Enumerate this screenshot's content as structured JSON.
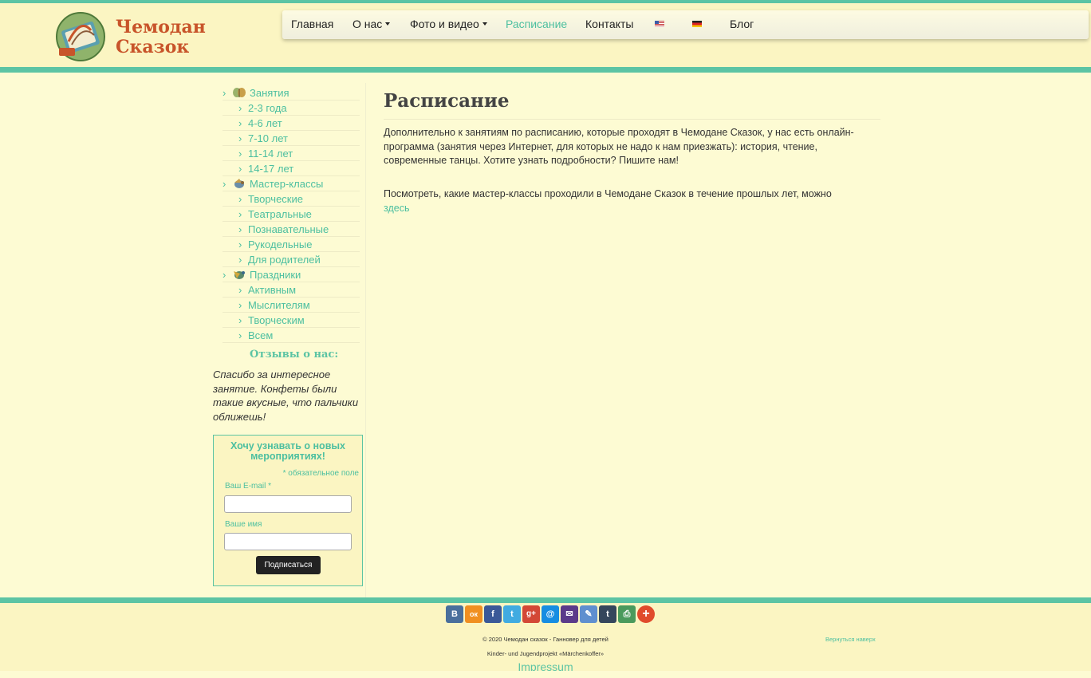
{
  "brand": {
    "line1": "Чемодан",
    "line2": "Сказок"
  },
  "nav": [
    {
      "label": "Главная"
    },
    {
      "label": "О нас"
    },
    {
      "label": "Фото и видео"
    },
    {
      "label": "Расписание",
      "active": true
    },
    {
      "label": "Контакты"
    },
    {
      "label": "Блог"
    }
  ],
  "sidebar": {
    "menu": [
      {
        "label": "Занятия",
        "level": 1,
        "icon": "butterfly-icon"
      },
      {
        "label": "2-3 года",
        "level": 2
      },
      {
        "label": "4-6 лет",
        "level": 2
      },
      {
        "label": "7-10 лет",
        "level": 2
      },
      {
        "label": "11-14 лет",
        "level": 2
      },
      {
        "label": "14-17 лет",
        "level": 2
      },
      {
        "label": "Мастер-классы",
        "level": 1,
        "icon": "bird-icon"
      },
      {
        "label": "Творческие",
        "level": 2
      },
      {
        "label": "Театральные",
        "level": 2
      },
      {
        "label": "Познавательные",
        "level": 2
      },
      {
        "label": "Рукодельные",
        "level": 2
      },
      {
        "label": "Для родителей",
        "level": 2
      },
      {
        "label": "Праздники",
        "level": 1,
        "icon": "bird-icon"
      },
      {
        "label": "Активным",
        "level": 2
      },
      {
        "label": "Мыслителям",
        "level": 2
      },
      {
        "label": "Творческим",
        "level": 2
      },
      {
        "label": "Всем",
        "level": 2
      }
    ],
    "reviews_title": "Отзывы о нас:",
    "review_text": "Спасибо за интересное занятие. Конфеты были такие вкусные, что пальчики оближешь!",
    "subscribe": {
      "title": "Хочу узнавать о новых мероприятиях!",
      "required_note": "* обязательное поле",
      "email_label": "Ваш E-mail *",
      "email_value": "",
      "name_label": "Ваше имя",
      "name_value": "",
      "button_label": "Подписаться"
    }
  },
  "main": {
    "title": "Расписание",
    "paragraph1": "Дополнительно к занятиям по расписанию, которые проходят в Чемодане Сказок, у нас есть онлайн-программа (занятия через Интернет, для которых не надо к нам приезжать): история, чтение, современные танцы. Хотите узнать подробности? Пишите нам!",
    "paragraph2": "Посмотреть, какие мастер-классы проходили в Чемодане Сказок в течение прошлых лет, можно",
    "link_label": "здесь"
  },
  "footer": {
    "share_buttons": [
      {
        "name": "vk-icon",
        "glyph": "В",
        "color": "#4a6f9c"
      },
      {
        "name": "odnoklassniki-icon",
        "glyph": "ок",
        "color": "#f08f21"
      },
      {
        "name": "facebook-icon",
        "glyph": "f",
        "color": "#3b5998"
      },
      {
        "name": "twitter-icon",
        "glyph": "t",
        "color": "#41abe1"
      },
      {
        "name": "google-plus-icon",
        "glyph": "g+",
        "color": "#d34836"
      },
      {
        "name": "mail-ru-icon",
        "glyph": "@",
        "color": "#168de2"
      },
      {
        "name": "email-icon",
        "glyph": "✉",
        "color": "#5b3a8a"
      },
      {
        "name": "livejournal-icon",
        "glyph": "✎",
        "color": "#5f8fcf"
      },
      {
        "name": "tumblr-icon",
        "glyph": "t",
        "color": "#35465c"
      },
      {
        "name": "print-icon",
        "glyph": "⎙",
        "color": "#4a9a5c"
      },
      {
        "name": "more-icon",
        "glyph": "+",
        "color": "#e04b2c"
      }
    ],
    "copyright": "© 2020 Чемодан сказок - Ганновер для детей",
    "subtitle": "Kinder- und Jugendprojekt «Märchenkoffer»",
    "back_to_top": "Вернуться наверх",
    "impressum": "Impressum"
  }
}
